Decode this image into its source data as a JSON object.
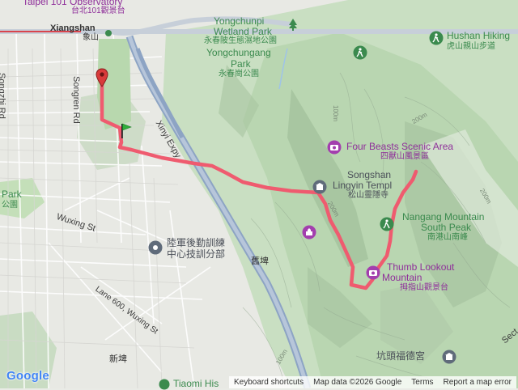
{
  "map": {
    "labels": {
      "taipei101": "Taipei 101 Observatory",
      "taipei101_zh": "台北101觀景台",
      "xiangshan": "Xiangshan",
      "xiangshan_zh": "象山",
      "yongchunpi": "Yongchunpi",
      "wetland_park": "Wetland Park",
      "yongchunpi_zh": "永春陂生態濕地公園",
      "yongchungang": "Yongchungang",
      "park": "Park",
      "yongchungang_zh": "永春崗公園",
      "hushan": "Hushan Hiking",
      "hushan_zh": "虎山親山步道",
      "songzhi": "Songzhi Rd",
      "songren": "Songren Rd",
      "xinyi": "Xinyi Expy",
      "four_beasts": "Four Beasts Scenic Area",
      "four_beasts_zh": "四獸山風景區",
      "songshan": "Songshan",
      "lingyin": "Lingyin Templ",
      "lingyin_zh": "松山靈隱寺",
      "nangang": "Nangang Mountain",
      "south_peak": "South Peak",
      "nangang_zh": "南港山南峰",
      "park_left": "Park",
      "park_left_zh": "公園",
      "wuxing": "Wuxing St",
      "army": "陸軍後勤訓練",
      "army2": "中心技訓分部",
      "jiukun": "舊埤",
      "lane600": "Lane 600, Wuxing St",
      "thumb": "Thumb Lookout",
      "mountain": "Mountain",
      "thumb_zh": "拇指山觀景台",
      "xinpi": "新埤",
      "kengtou": "坑頭福德宮",
      "tiaomi": "Tiaomi His",
      "sect": "Sect",
      "c100": "100m",
      "c200a": "200m",
      "c200b": "200m",
      "c200c": "200m",
      "c100b": "100m"
    },
    "logo": "Google",
    "attribution": {
      "shortcuts": "Keyboard shortcuts",
      "data": "Map data ©2026 Google",
      "terms": "Terms",
      "report": "Report a map error"
    },
    "colors": {
      "track": "#ef5b6f",
      "poi": "#8f2f9a",
      "park": "#3b8a4e",
      "highway": "#8da4c4"
    },
    "markers": {
      "end": "red-map-pin-icon",
      "start": "green-flag-icon"
    }
  }
}
